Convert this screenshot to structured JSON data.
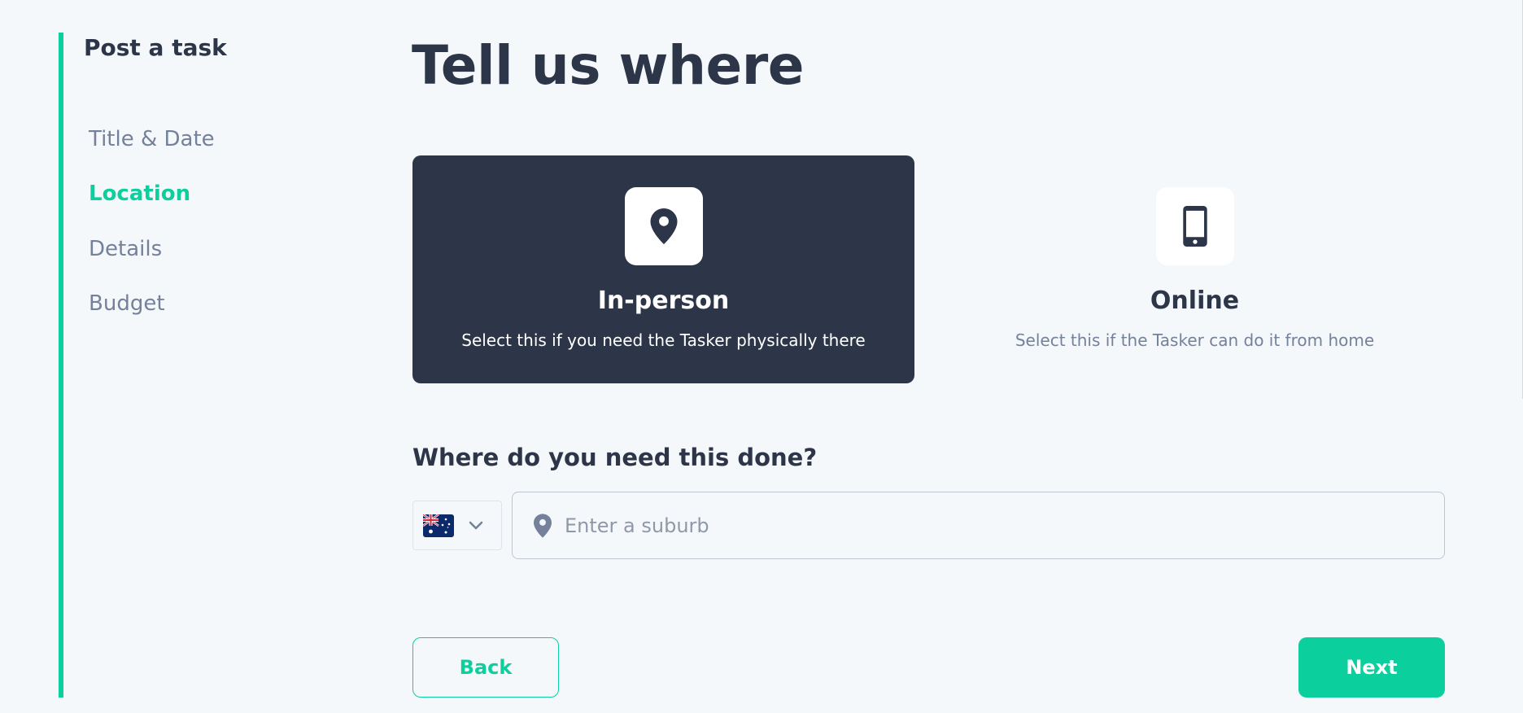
{
  "sidebar": {
    "title": "Post a task",
    "items": [
      {
        "label": "Title & Date"
      },
      {
        "label": "Location"
      },
      {
        "label": "Details"
      },
      {
        "label": "Budget"
      }
    ],
    "active_index": 1
  },
  "main": {
    "title": "Tell us where",
    "options": [
      {
        "title": "In-person",
        "description": "Select this if you need the Tasker physically there",
        "icon": "location-pin-icon",
        "selected": true
      },
      {
        "title": "Online",
        "description": "Select this if the Tasker can do it from home",
        "icon": "mobile-phone-icon",
        "selected": false
      }
    ],
    "question": "Where do you need this done?",
    "country": {
      "flag": "australia-flag"
    },
    "suburb": {
      "placeholder": "Enter a suburb",
      "value": ""
    }
  },
  "actions": {
    "back_label": "Back",
    "next_label": "Next"
  },
  "colors": {
    "accent": "#0ccf9e",
    "dark": "#2d3648",
    "muted": "#75819a",
    "background": "#f5f8fb"
  }
}
